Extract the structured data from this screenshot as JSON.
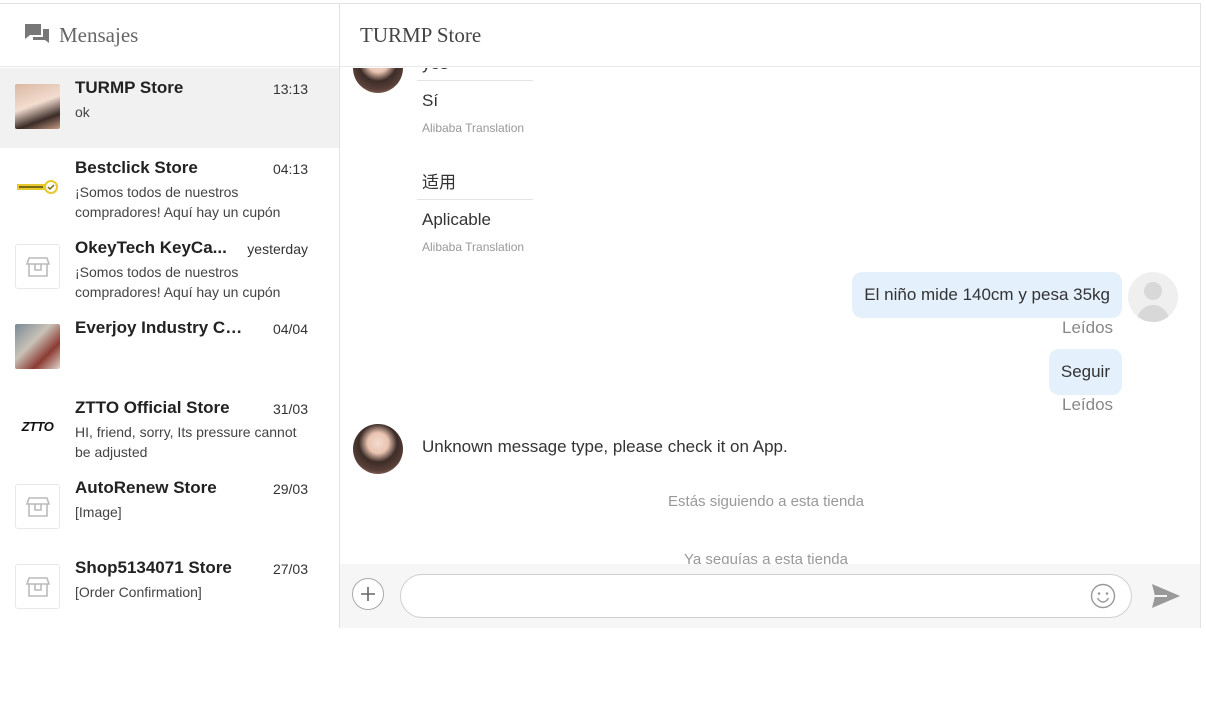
{
  "sidebar": {
    "title": "Mensajes",
    "icon": "chat-bubbles-icon",
    "conversations": [
      {
        "name": "TURMP Store",
        "time": "13:13",
        "preview": "ok",
        "avatar": "store-photo-avatar",
        "active": true
      },
      {
        "name": "Bestclick Store",
        "time": "04:13",
        "preview": "¡Somos todos de nuestros compradores! Aquí hay un cupón para...",
        "avatar": "bestclick-logo-avatar"
      },
      {
        "name": "OkeyTech KeyCa...",
        "time": "yesterday",
        "preview": "¡Somos todos de nuestros compradores! Aquí hay un cupón para...",
        "avatar": "default-store-icon"
      },
      {
        "name": "Everjoy Industry Co....",
        "time": "04/04",
        "preview": "",
        "avatar": "bike-photo-avatar"
      },
      {
        "name": "ZTTO Official Store",
        "time": "31/03",
        "preview": "HI, friend, sorry, Its pressure cannot be adjusted",
        "avatar": "ztto-logo-avatar",
        "logo_text": "ZTTO"
      },
      {
        "name": "AutoRenew Store",
        "time": "29/03",
        "preview": "[Image]",
        "avatar": "default-store-icon"
      },
      {
        "name": "Shop5134071 Store",
        "time": "27/03",
        "preview": "[Order Confirmation]",
        "avatar": "default-store-icon"
      }
    ]
  },
  "chat": {
    "title": "TURMP Store",
    "messages": {
      "partial_original": "yes",
      "translation_1": {
        "text": "Sí",
        "source": "Alibaba Translation"
      },
      "original_2": "适用",
      "translation_2": {
        "text": "Aplicable",
        "source": "Alibaba Translation"
      },
      "outgoing_1": "El niño mide 140cm y pesa 35kg",
      "read_1": "Leídos",
      "outgoing_2": "Seguir",
      "read_2": "Leídos",
      "incoming_unknown": "Unknown message type, please check it on App.",
      "system_1": "Estás siguiendo a esta tienda",
      "system_2": "Ya seguías a esta tienda"
    },
    "composer": {
      "placeholder": "",
      "value": "",
      "plus_icon": "plus-icon",
      "emoji_icon": "smiley-icon",
      "send_icon": "send-icon"
    }
  }
}
